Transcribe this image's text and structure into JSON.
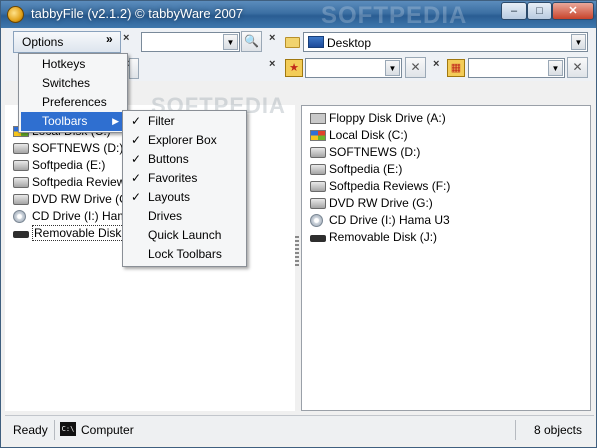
{
  "window": {
    "title": "tabbyFile (v2.1.2) © tabbyWare 2007",
    "watermark": "SOFTPEDIA",
    "controls": {
      "minimize": "–",
      "maximize": "□",
      "close": "✕"
    }
  },
  "toolbar": {
    "options_label": "Options",
    "chevron": "»",
    "close_glyph": "×",
    "location_value": "Desktop",
    "search_icon": "search-icon",
    "remove_glyph": "✕"
  },
  "menu": {
    "items": [
      "Hotkeys",
      "Switches",
      "Preferences",
      "Toolbars"
    ],
    "submenu_arrow": "▶"
  },
  "submenu": {
    "items": [
      {
        "label": "Filter",
        "checked": true
      },
      {
        "label": "Explorer Box",
        "checked": true
      },
      {
        "label": "Buttons",
        "checked": true
      },
      {
        "label": "Favorites",
        "checked": true
      },
      {
        "label": "Layouts",
        "checked": true
      },
      {
        "label": "Drives",
        "checked": false
      },
      {
        "label": "Quick Launch",
        "checked": false
      },
      {
        "label": "Lock Toolbars",
        "checked": false
      }
    ],
    "check_glyph": "✓"
  },
  "left_panel": {
    "drives": [
      "Local Disk (C:)",
      "SOFTNEWS (D:)",
      "Softpedia (E:)",
      "Softpedia Reviews",
      "DVD RW Drive (G:",
      "CD Drive (I:) Hama",
      "Removable Disk (J:"
    ],
    "watermark": "SOFTPEDIA"
  },
  "right_panel": {
    "drives": [
      "Floppy Disk Drive (A:)",
      "Local Disk (C:)",
      "SOFTNEWS (D:)",
      "Softpedia (E:)",
      "Softpedia Reviews (F:)",
      "DVD RW Drive (G:)",
      "CD Drive (I:) Hama U3",
      "Removable Disk (J:)"
    ]
  },
  "statusbar": {
    "ready": "Ready",
    "cmd_icon_text": "C:\\",
    "location": "Computer",
    "count": "8 objects"
  }
}
